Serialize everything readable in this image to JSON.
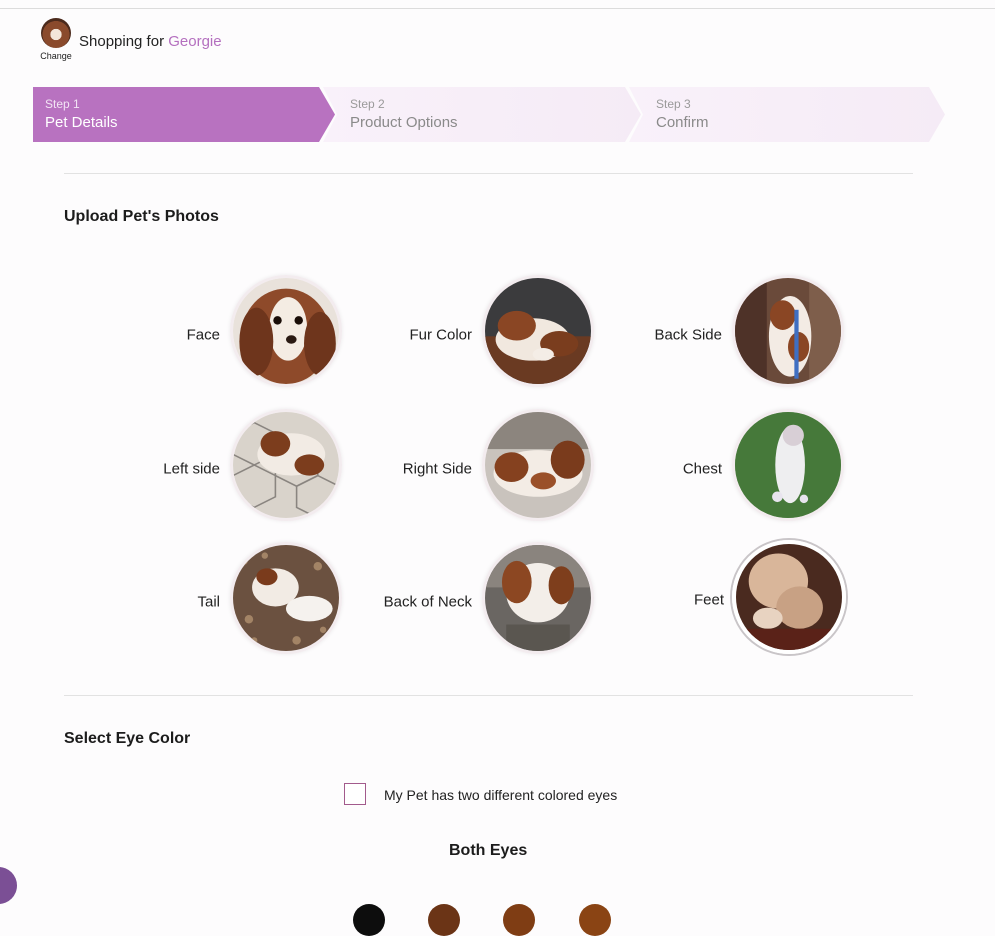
{
  "header": {
    "avatar_change": "Change",
    "shopping_prefix": "Shopping for ",
    "pet_name": "Georgie"
  },
  "steps": [
    {
      "num": "Step 1",
      "name": "Pet Details",
      "state": "active"
    },
    {
      "num": "Step 2",
      "name": "Product Options",
      "state": "inactive"
    },
    {
      "num": "Step 3",
      "name": "Confirm",
      "state": "inactive"
    }
  ],
  "upload": {
    "title": "Upload Pet's Photos",
    "photos": [
      {
        "label": "Face"
      },
      {
        "label": "Fur Color"
      },
      {
        "label": "Back Side"
      },
      {
        "label": "Left side"
      },
      {
        "label": "Right Side"
      },
      {
        "label": "Chest"
      },
      {
        "label": "Tail"
      },
      {
        "label": "Back of Neck"
      },
      {
        "label": "Feet"
      }
    ]
  },
  "eye": {
    "title": "Select Eye Color",
    "two_colors_label": "My Pet has two different colored eyes",
    "both_eyes_label": "Both Eyes",
    "swatches": [
      "#0d0d0d",
      "#6b3416",
      "#7f3d14",
      "#8a4414"
    ]
  },
  "colors": {
    "accent": "#b872c0",
    "pet_name": "#b46fbf",
    "chat_bubble": "#7b4f95"
  }
}
